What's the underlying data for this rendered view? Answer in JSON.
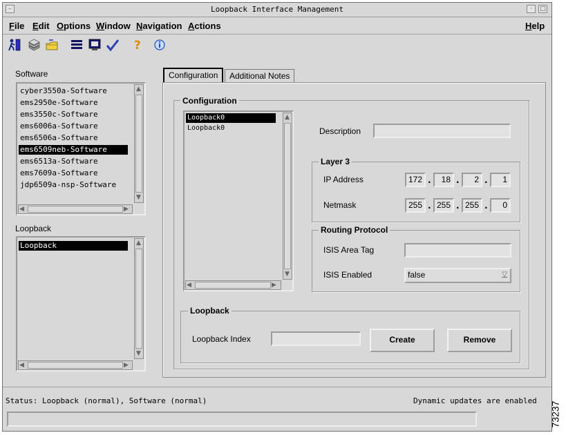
{
  "window": {
    "title": "Loopback Interface Management"
  },
  "menubar": [
    "File",
    "Edit",
    "Options",
    "Window",
    "Navigation",
    "Actions"
  ],
  "help_menu": "Help",
  "toolbar": [
    "exit-icon",
    "database-icon",
    "folder-icon",
    "list-icon",
    "monitor-icon",
    "check-icon",
    "help-icon",
    "info-icon"
  ],
  "software": {
    "label": "Software",
    "items": [
      "cyber3550a-Software",
      "ems2950e-Software",
      "ems3550c-Software",
      "ems6006a-Software",
      "ems6506a-Software",
      "ems6509neb-Software",
      "ems6513a-Software",
      "ems7609a-Software",
      "jdp6509a-nsp-Software"
    ],
    "selected": "ems6509neb-Software"
  },
  "loopback_list": {
    "label": "Loopback",
    "items": [
      "Loopback"
    ],
    "selected": "Loopback"
  },
  "tabs": [
    "Configuration",
    "Additional Notes"
  ],
  "active_tab": "Configuration",
  "config": {
    "group_title": "Configuration",
    "interfaces": [
      "Loopback0",
      "Loopback0"
    ],
    "description_label": "Description",
    "description_value": "",
    "layer3": {
      "title": "Layer 3",
      "ip_label": "IP Address",
      "ip": [
        "172",
        "18",
        "2",
        "1"
      ],
      "netmask_label": "Netmask",
      "netmask": [
        "255",
        "255",
        "255",
        "0"
      ]
    },
    "routing": {
      "title": "Routing Protocol",
      "isis_tag_label": "ISIS Area Tag",
      "isis_tag_value": "",
      "isis_enabled_label": "ISIS Enabled",
      "isis_enabled_value": "false"
    },
    "loopback": {
      "title": "Loopback",
      "index_label": "Loopback Index",
      "index_value": "",
      "create_label": "Create",
      "remove_label": "Remove"
    }
  },
  "status": {
    "text": "Status: Loopback (normal), Software (normal)",
    "updates": "Dynamic updates are enabled"
  },
  "figure_id": "73237"
}
